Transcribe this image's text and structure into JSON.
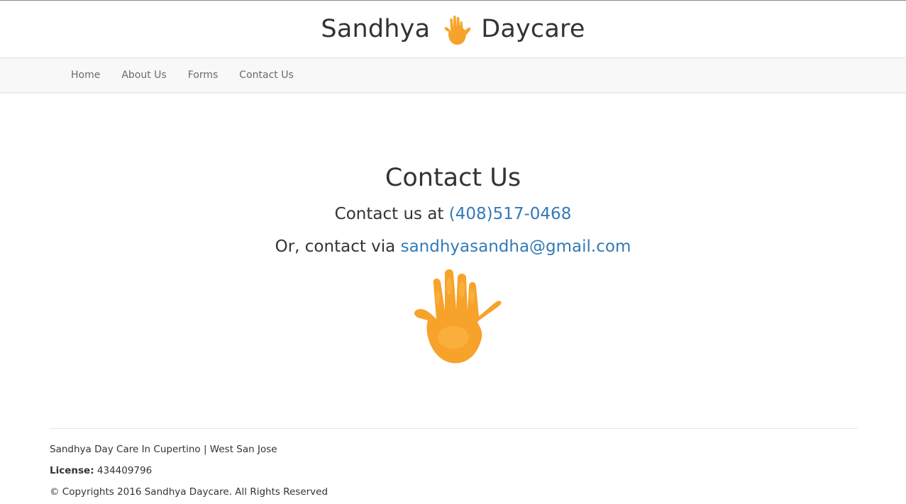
{
  "brand": {
    "name_left": "Sandhya",
    "name_right": "Daycare",
    "logo_icon": "orange-handprint-icon"
  },
  "nav": {
    "items": [
      {
        "label": "Home"
      },
      {
        "label": "About Us"
      },
      {
        "label": "Forms"
      },
      {
        "label": "Contact Us"
      }
    ]
  },
  "main": {
    "title": "Contact Us",
    "phone_prefix": "Contact us at ",
    "phone": "(408)517-0468",
    "email_prefix": "Or, contact via ",
    "email": "sandhyasandha@gmail.com",
    "image_icon": "orange-handprint-image"
  },
  "footer": {
    "location": "Sandhya Day Care In Cupertino | West San Jose",
    "license_label": "License:",
    "license_number": "434409796",
    "copyright": "© Copyrights 2016 Sandhya Daycare. All Rights Reserved"
  },
  "colors": {
    "link": "#337ab7",
    "handprint": "#f7a22b",
    "navbar_bg": "#f8f8f8"
  }
}
